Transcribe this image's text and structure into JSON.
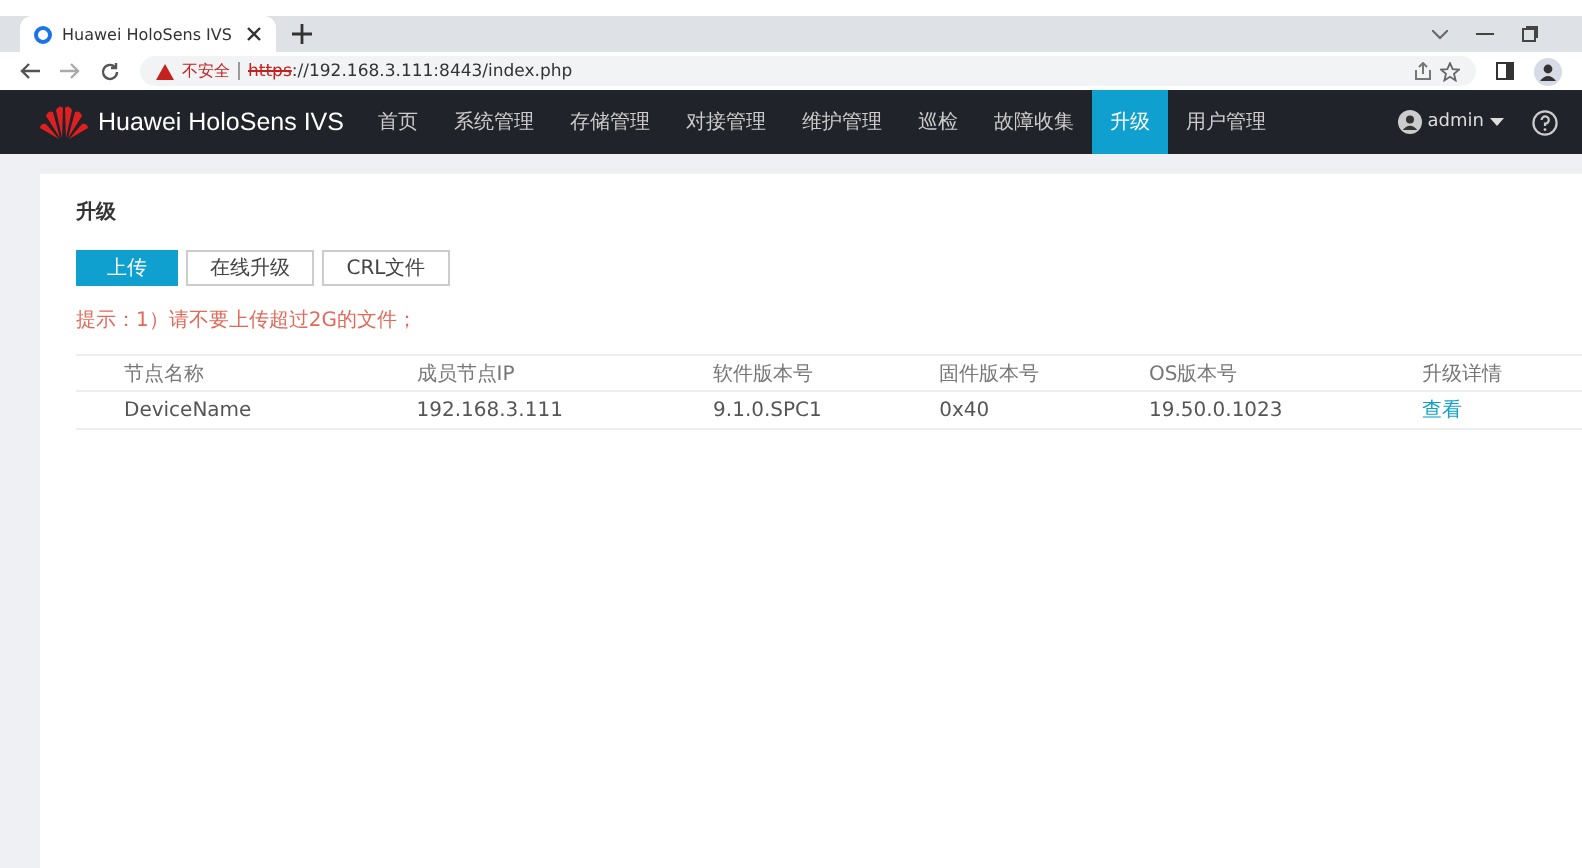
{
  "browser": {
    "tab_title": "Huawei HoloSens IVS",
    "security": "不安全",
    "url_scheme": "https",
    "url_rest": "://192.168.3.111:8443/index.php"
  },
  "app": {
    "title": "Huawei HoloSens IVS",
    "user": "admin"
  },
  "nav": [
    {
      "label": "首页",
      "selected": false
    },
    {
      "label": "系统管理",
      "selected": false
    },
    {
      "label": "存储管理",
      "selected": false
    },
    {
      "label": "对接管理",
      "selected": false
    },
    {
      "label": "维护管理",
      "selected": false
    },
    {
      "label": "巡检",
      "selected": false
    },
    {
      "label": "故障收集",
      "selected": false
    },
    {
      "label": "升级",
      "selected": true
    },
    {
      "label": "用户管理",
      "selected": false
    }
  ],
  "page": {
    "heading": "升级",
    "hint": "提示：1）请不要上传超过2G的文件；"
  },
  "buttons": [
    {
      "label": "上传",
      "selected": true
    },
    {
      "label": "在线升级",
      "selected": false
    },
    {
      "label": "CRL文件",
      "selected": false
    }
  ],
  "table": {
    "columns": [
      "节点名称",
      "成员节点IP",
      "软件版本号",
      "固件版本号",
      "OS版本号",
      "升级详情"
    ],
    "rows": [
      [
        "DeviceName",
        "192.168.3.111",
        "9.1.0.SPC1",
        "0x40",
        "19.50.0.1023",
        "查看"
      ]
    ]
  }
}
